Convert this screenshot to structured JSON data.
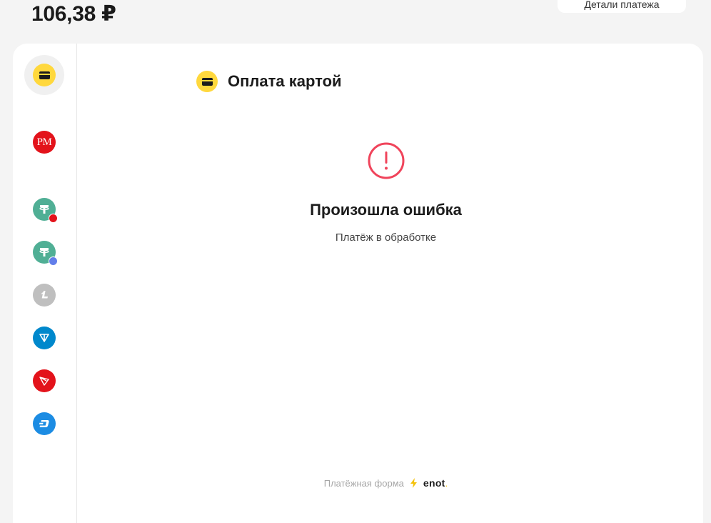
{
  "order": {
    "amount": "106,38 ₽",
    "details_label": "Детали платежа"
  },
  "methods": [
    {
      "name": "Банковская карта",
      "icon": "card-icon",
      "color": "#FFD83D",
      "active": true
    },
    {
      "name": "PM",
      "icon": "perfect-money-icon",
      "color": "#E3131B"
    },
    {
      "name": "USDT TRC20",
      "icon": "tether-trc20-icon",
      "color": "#50AF95",
      "badge_color": "#E3131B"
    },
    {
      "name": "USDT ERC20",
      "icon": "tether-erc20-icon",
      "color": "#50AF95",
      "badge_color": "#627EEA"
    },
    {
      "name": "Litecoin",
      "icon": "litecoin-icon",
      "color": "#BFBFBF"
    },
    {
      "name": "TON",
      "icon": "ton-icon",
      "color": "#0088CC"
    },
    {
      "name": "TRON",
      "icon": "tron-icon",
      "color": "#E3131B"
    },
    {
      "name": "Dash",
      "icon": "dash-icon",
      "color": "#1C8CE3"
    }
  ],
  "header": {
    "title": "Оплата картой",
    "icon": "card-icon"
  },
  "error": {
    "icon": "error-exclamation-icon",
    "title": "Произошла ошибка",
    "subtitle": "Платёж в обработке",
    "color": "#F0445B"
  },
  "footer": {
    "text": "Платёжная форма",
    "brand": "enot",
    "brand_dot": ".",
    "bolt_color": "#F4C20D"
  }
}
